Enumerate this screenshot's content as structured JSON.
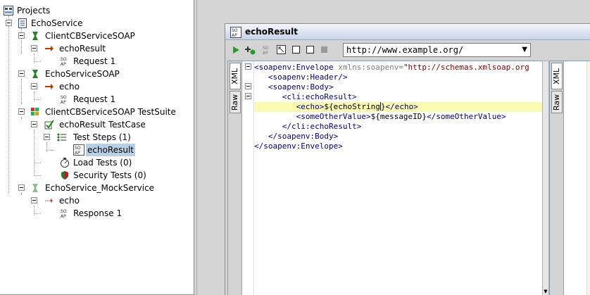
{
  "navigator": {
    "root_label": "Projects",
    "items": [
      {
        "label": "EchoService",
        "icon": "project-icon"
      },
      {
        "label": "ClientCBServiceSOAP",
        "icon": "interface-icon"
      },
      {
        "label": "echoResult",
        "icon": "operation-icon"
      },
      {
        "label": "Request 1",
        "icon": "request-icon"
      },
      {
        "label": "EchoServiceSOAP",
        "icon": "interface-icon"
      },
      {
        "label": "echo",
        "icon": "operation-icon"
      },
      {
        "label": "Request 1",
        "icon": "request-icon"
      },
      {
        "label": "ClientCBServiceSOAP TestSuite",
        "icon": "testsuite-icon"
      },
      {
        "label": "echoResult TestCase",
        "icon": "testcase-icon"
      },
      {
        "label": "Test Steps (1)",
        "icon": "teststeps-icon"
      },
      {
        "label": "echoResult",
        "icon": "request-icon",
        "selected": true
      },
      {
        "label": "Load Tests (0)",
        "icon": "loadtest-icon"
      },
      {
        "label": "Security Tests (0)",
        "icon": "security-icon"
      },
      {
        "label": "EchoService_MockService",
        "icon": "mockservice-icon"
      },
      {
        "label": "echo",
        "icon": "mock-operation-icon"
      },
      {
        "label": "Response 1",
        "icon": "request-icon"
      }
    ]
  },
  "editor": {
    "title": "echoResult",
    "endpoint": "http://www.example.org/",
    "request_tabs": [
      "XML",
      "Raw"
    ],
    "response_tabs": [
      "XML",
      "Raw"
    ],
    "xml": {
      "l1_tag": "<soapenv:Envelope",
      "l1_attr": "xmlns:soapenv=",
      "l1_val": "\"http://schemas.xmlsoap.org",
      "l2": "<soapenv:Header/>",
      "l3": "<soapenv:Body>",
      "l4": "<cli:echoResult>",
      "l5_open": "<echo>",
      "l5_text_a": "${echoString",
      "l5_text_b": "}",
      "l5_close": "</echo>",
      "l6_open": "<someOtherValue>",
      "l6_text": "${messageID}",
      "l6_close": "</someOtherValue>",
      "l7": "</cli:echoResult>",
      "l8": "</soapenv:Body>",
      "l9": "</soapenv:Envelope>"
    }
  },
  "colors": {
    "selection": "#b8cfe5",
    "highlight_line": "#fcfbb2",
    "xml_tag": "#000080",
    "xml_attr": "#808080",
    "xml_string": "#800000"
  }
}
